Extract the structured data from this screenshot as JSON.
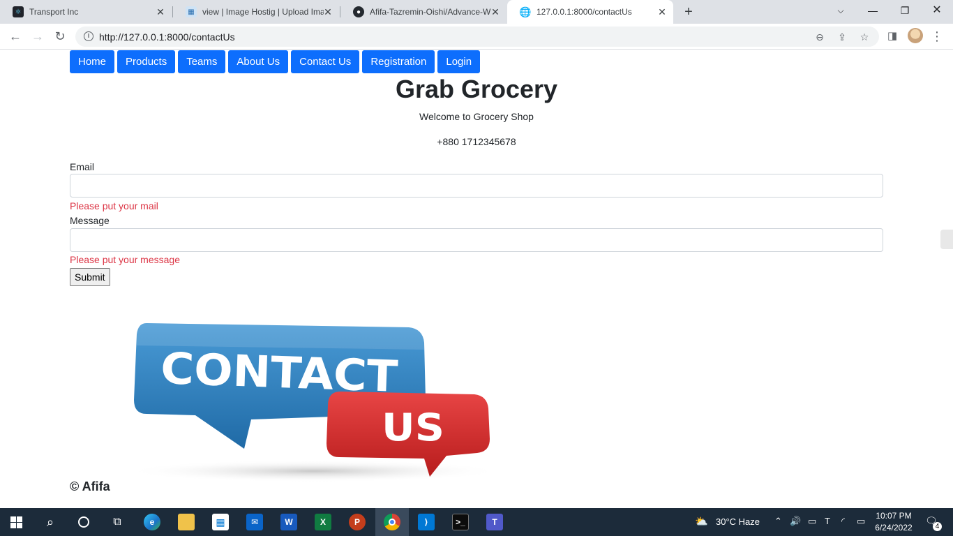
{
  "browser": {
    "tabs": [
      {
        "title": "Transport Inc",
        "active": false
      },
      {
        "title": "view | Image Hostig | Upload Ima",
        "active": false
      },
      {
        "title": "Afifa-Tazremin-Oishi/Advance-W",
        "active": false
      },
      {
        "title": "127.0.0.1:8000/contactUs",
        "active": true
      }
    ],
    "new_tab": "+",
    "url": "http://127.0.0.1:8000/contactUs"
  },
  "nav": [
    "Home",
    "Products",
    "Teams",
    "About Us",
    "Contact Us",
    "Registration",
    "Login"
  ],
  "header": {
    "title": "Grab Grocery",
    "welcome": "Welcome to Grocery Shop",
    "phone": "+880 1712345678"
  },
  "form": {
    "email_label": "Email",
    "email_value": "",
    "email_error": "Please put your mail",
    "message_label": "Message",
    "message_value": "",
    "message_error": "Please put your message",
    "submit_label": "Submit"
  },
  "image": {
    "contact": "CONTACT",
    "us": "US"
  },
  "footer": {
    "copyright": "© Afifa"
  },
  "taskbar": {
    "weather": "30°C  Haze",
    "time": "10:07 PM",
    "date": "6/24/2022",
    "notifications": "4"
  },
  "colors": {
    "nav_button": "#0d6efd",
    "error": "#dc3545",
    "bubble_blue": "#2f7fbf",
    "bubble_red": "#d52a2a"
  }
}
